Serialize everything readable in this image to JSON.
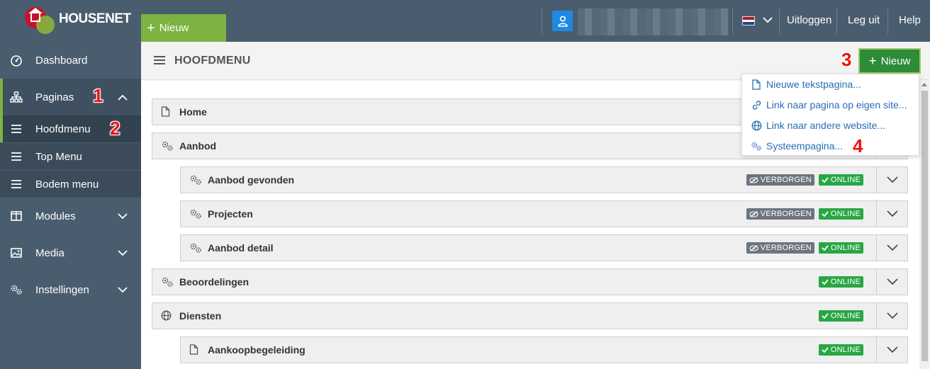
{
  "brand": {
    "name": "HOUSENET"
  },
  "topbar": {
    "new_label": "Nieuw",
    "links": [
      "Uitloggen",
      "Leg uit",
      "Help"
    ]
  },
  "sidebar": {
    "items": [
      {
        "label": "Dashboard",
        "icon": "dashboard-icon"
      },
      {
        "label": "Paginas",
        "icon": "sitemap-icon"
      },
      {
        "label": "Hoofdmenu",
        "icon": "menu-icon"
      },
      {
        "label": "Top Menu",
        "icon": "menu-icon"
      },
      {
        "label": "Bodem menu",
        "icon": "menu-icon"
      },
      {
        "label": "Modules",
        "icon": "columns-icon"
      },
      {
        "label": "Media",
        "icon": "image-icon"
      },
      {
        "label": "Instellingen",
        "icon": "gears-icon"
      }
    ]
  },
  "main": {
    "title": "HOOFDMENU",
    "new_label": "Nieuw"
  },
  "dropdown": {
    "items": [
      {
        "label": "Nieuwe tekstpagina...",
        "icon": "file-icon"
      },
      {
        "label": "Link naar pagina op eigen site...",
        "icon": "link-icon"
      },
      {
        "label": "Link naar andere website...",
        "icon": "globe-icon"
      },
      {
        "label": "Systeempagina...",
        "icon": "gears-icon"
      }
    ]
  },
  "badges": {
    "hidden": "VERBORGEN",
    "online": "ONLINE"
  },
  "rows": [
    {
      "label": "Home",
      "icon": "file-icon",
      "indent": false,
      "hidden": false,
      "online": false
    },
    {
      "label": "Aanbod",
      "icon": "gears-icon",
      "indent": false,
      "hidden": false,
      "online": false
    },
    {
      "label": "Aanbod gevonden",
      "icon": "gears-icon",
      "indent": true,
      "hidden": true,
      "online": true
    },
    {
      "label": "Projecten",
      "icon": "gears-icon",
      "indent": true,
      "hidden": true,
      "online": true
    },
    {
      "label": "Aanbod detail",
      "icon": "gears-icon",
      "indent": true,
      "hidden": true,
      "online": true
    },
    {
      "label": "Beoordelingen",
      "icon": "gears-icon",
      "indent": false,
      "hidden": false,
      "online": true
    },
    {
      "label": "Diensten",
      "icon": "globe-icon",
      "indent": false,
      "hidden": false,
      "online": true
    },
    {
      "label": "Aankoopbegeleiding",
      "icon": "file-icon",
      "indent": true,
      "hidden": false,
      "online": true
    }
  ],
  "annotations": [
    "1",
    "2",
    "3",
    "4"
  ],
  "colors": {
    "sidebar": "#4a5d6e",
    "accent_green": "#7cb342",
    "button_green": "#2e8b3a",
    "link_blue": "#2a6db5",
    "badge_online": "#28a745",
    "badge_hidden": "#6c757d"
  }
}
